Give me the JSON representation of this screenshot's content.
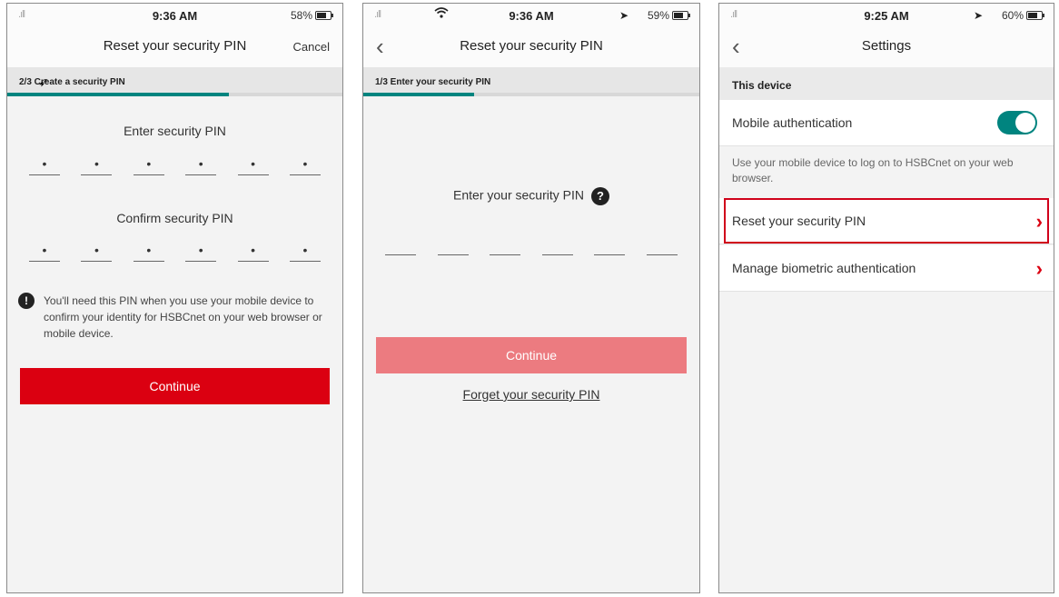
{
  "screen1": {
    "status": {
      "signal": ".ıll",
      "time": "9:36 AM",
      "battery": "58%"
    },
    "nav": {
      "title": "Reset your security PIN",
      "cancel": "Cancel"
    },
    "step_label": "2/3 Create a security PIN",
    "progress": 0.66,
    "enter_label": "Enter security PIN",
    "confirm_label": "Confirm security PIN",
    "pin_dots": [
      "•",
      "•",
      "•",
      "•",
      "•",
      "•"
    ],
    "info_icon": "!",
    "info_text": "You'll need this PIN when you use your mobile device to confirm your identity for HSBCnet on your web browser or mobile device.",
    "continue": "Continue"
  },
  "screen2": {
    "status": {
      "signal": ".ıll",
      "time": "9:36 AM",
      "battery": "59%"
    },
    "nav": {
      "back": "‹",
      "title": "Reset your security PIN"
    },
    "step_label": "1/3 Enter your security PIN",
    "progress": 0.33,
    "enter_label": "Enter your security PIN",
    "help_icon": "?",
    "continue": "Continue",
    "forget_link": "Forget your security PIN"
  },
  "screen3": {
    "status": {
      "signal": ".ıll",
      "time": "9:25 AM",
      "battery": "60%"
    },
    "nav": {
      "back": "‹",
      "title": "Settings"
    },
    "section": "This device",
    "mobile_auth": "Mobile authentication",
    "mobile_auth_enabled": true,
    "description": "Use your mobile device to log on to HSBCnet on your web browser.",
    "reset_pin": "Reset your security PIN",
    "manage_bio": "Manage biometric authentication"
  },
  "colors": {
    "brand_red": "#db0011",
    "teal": "#00847f",
    "disabled_red": "#ec7b80"
  },
  "icons": {
    "chevron": "›",
    "location": "➤",
    "wifi": "wifi-icon",
    "battery": "battery-icon",
    "cursor": "cursor-icon"
  }
}
